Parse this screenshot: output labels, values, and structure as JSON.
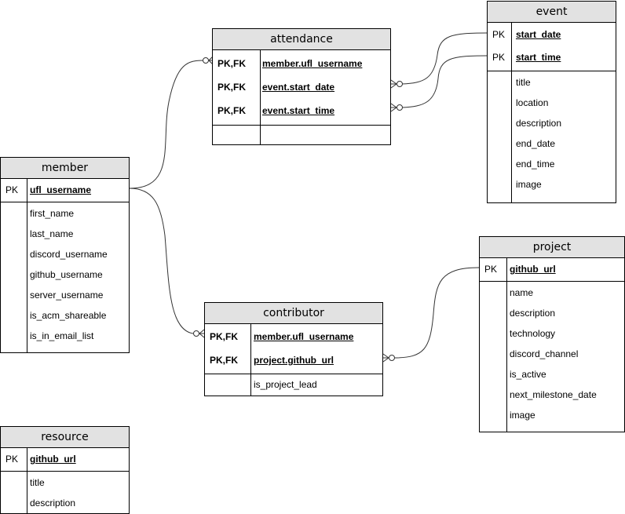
{
  "entities": {
    "attendance": {
      "title": "attendance",
      "keys": [
        {
          "key": "PK,FK",
          "field": "member.ufl_username"
        },
        {
          "key": "PK,FK",
          "field": "event.start_date"
        },
        {
          "key": "PK,FK",
          "field": "event.start_time"
        }
      ],
      "attributes": []
    },
    "event": {
      "title": "event",
      "keys": [
        {
          "key": "PK",
          "field": "start_date"
        },
        {
          "key": "PK",
          "field": "start_time"
        }
      ],
      "attributes": [
        "title",
        "location",
        "description",
        "end_date",
        "end_time",
        "image"
      ]
    },
    "member": {
      "title": "member",
      "keys": [
        {
          "key": "PK",
          "field": "ufl_username"
        }
      ],
      "attributes": [
        "first_name",
        "last_name",
        "discord_username",
        "github_username",
        "server_username",
        "is_acm_shareable",
        "is_in_email_list"
      ]
    },
    "contributor": {
      "title": "contributor",
      "keys": [
        {
          "key": "PK,FK",
          "field": "member.ufl_username"
        },
        {
          "key": "PK,FK",
          "field": "project.github_url"
        }
      ],
      "attributes": [
        "is_project_lead"
      ]
    },
    "project": {
      "title": "project",
      "keys": [
        {
          "key": "PK",
          "field": "github_url"
        }
      ],
      "attributes": [
        "name",
        "description",
        "technology",
        "discord_channel",
        "is_active",
        "next_milestone_date",
        "image"
      ]
    },
    "resource": {
      "title": "resource",
      "keys": [
        {
          "key": "PK",
          "field": "github_url"
        }
      ],
      "attributes": [
        "title",
        "description"
      ]
    }
  },
  "relationships": [
    {
      "from": "member.ufl_username",
      "to": "attendance.member.ufl_username",
      "from_end": "one",
      "to_end": "zero-or-many"
    },
    {
      "from": "event.start_date",
      "to": "attendance.event.start_date",
      "from_end": "one",
      "to_end": "zero-or-many"
    },
    {
      "from": "event.start_time",
      "to": "attendance.event.start_time",
      "from_end": "one",
      "to_end": "zero-or-many"
    },
    {
      "from": "member.ufl_username",
      "to": "contributor.member.ufl_username",
      "from_end": "one",
      "to_end": "zero-or-many"
    },
    {
      "from": "project.github_url",
      "to": "contributor.project.github_url",
      "from_end": "one",
      "to_end": "zero-or-many"
    }
  ],
  "colors": {
    "header_bg": "#e2e2e2",
    "line": "#000000"
  }
}
